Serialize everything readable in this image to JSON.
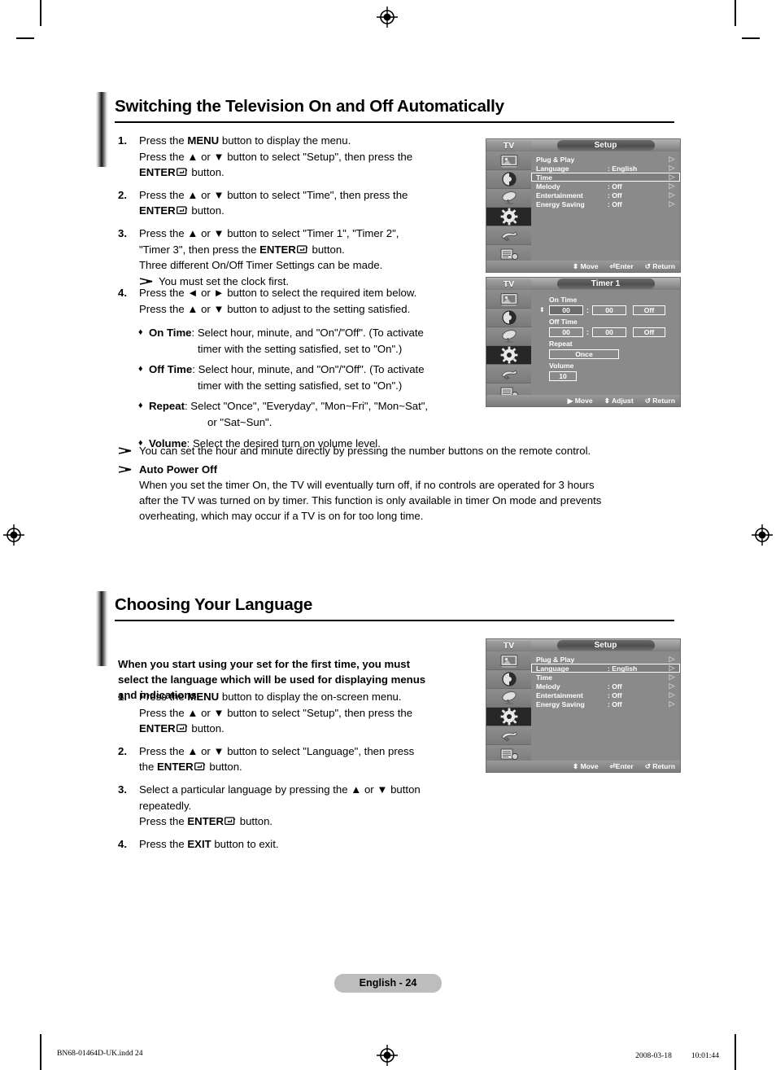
{
  "document": {
    "page_label": "English - 24",
    "footer_left": "BN68-01464D-UK.indd   24",
    "footer_right": "2008-03-18   　　 10:01:44"
  },
  "section1": {
    "title": "Switching the Television On and Off Automatically",
    "steps": [
      {
        "num": "1.",
        "lines": [
          "Press the MENU button to display the menu.",
          "Press the ▲ or ▼ button to select \"Setup\", then press the",
          "ENTER↵ button."
        ]
      },
      {
        "num": "2.",
        "lines": [
          "Press the ▲ or ▼ button to select \"Time\", then press the",
          "ENTER↵ button."
        ]
      },
      {
        "num": "3.",
        "lines": [
          "Press the ▲ or ▼ button to select \"Timer 1\", \"Timer 2\",",
          "\"Timer 3\", then press the ENTER↵ button.",
          "Three different On/Off Timer Settings can be made."
        ],
        "note": "You must set the clock first."
      },
      {
        "num": "4.",
        "lines": [
          "Press the ◄ or ► button to select the required item below.",
          "Press the ▲ or ▼ button to adjust to the setting satisfied."
        ]
      }
    ],
    "bullets": [
      {
        "label": "On  Time",
        "body": ": Select hour, minute, and \"On\"/\"Off\". (To activate",
        "body2": "timer with the setting satisfied, set to \"On\".)"
      },
      {
        "label": "Off  Time",
        "body": ": Select hour, minute, and \"On\"/\"Off\". (To activate",
        "body2": "timer with the setting satisfied, set to \"On\".)"
      },
      {
        "label": "Repeat",
        "body": ": Select \"Once\", \"Everyday\", \"Mon~Fri\", \"Mon~Sat\",",
        "body2": "or \"Sat~Sun\"."
      },
      {
        "label": "Volume",
        "body": ": Select the desired turn on volume level.",
        "body2": ""
      }
    ],
    "notes": [
      {
        "text": "You can set the hour and minute directly by pressing the number buttons on the remote control."
      },
      {
        "heading": "Auto Power Off",
        "lines": [
          "When you set the timer On, the TV will eventually turn off, if no controls are operated for 3 hours",
          "after the TV was turned on by timer. This function is only available in timer On mode and prevents",
          "overheating, which may occur if a TV is on for too long time."
        ]
      }
    ]
  },
  "section2": {
    "title": "Choosing Your Language",
    "intro": [
      "When you start using your set for the first time, you must",
      "select the language which will be used for displaying menus",
      "and indications."
    ],
    "steps": [
      {
        "num": "1.",
        "lines": [
          "Press the MENU button to display the on-screen menu.",
          "Press the ▲ or ▼ button to select \"Setup\", then press the",
          "ENTER↵ button."
        ]
      },
      {
        "num": "2.",
        "lines": [
          "Press the ▲ or ▼ button to select \"Language\", then press",
          "the ENTER↵ button."
        ]
      },
      {
        "num": "3.",
        "lines": [
          "Select a particular language by pressing the ▲ or ▼ button",
          "repeatedly.",
          "Press the ENTER↵ button."
        ]
      },
      {
        "num": "4.",
        "lines": [
          "Press the EXIT button to exit."
        ]
      }
    ]
  },
  "osd_setup_top": {
    "tv_label": "TV",
    "title": "Setup",
    "rows": [
      {
        "name": "Plug & Play",
        "value": "",
        "arrow": "▷",
        "selected": false
      },
      {
        "name": "Language",
        "value": ": English",
        "arrow": "▷",
        "selected": false
      },
      {
        "name": "Time",
        "value": "",
        "arrow": "▷",
        "selected": true
      },
      {
        "name": "Melody",
        "value": ": Off",
        "arrow": "▷",
        "selected": false
      },
      {
        "name": "Entertainment",
        "value": ": Off",
        "arrow": "▷",
        "selected": false
      },
      {
        "name": "Energy Saving",
        "value": ": Off",
        "arrow": "▷",
        "selected": false
      }
    ],
    "footer": {
      "move": "Move",
      "enter": "Enter",
      "return": "Return"
    },
    "icons": [
      "picture-icon",
      "sound-icon",
      "channel-icon",
      "setup-icon",
      "input-icon",
      "pc-setup-icon"
    ],
    "active_icon_index": 3
  },
  "osd_timer": {
    "tv_label": "TV",
    "title": "Timer 1",
    "on_time_label": "On Time",
    "on_time": {
      "hour": "00",
      "minute": "00",
      "state": "Off"
    },
    "off_time_label": "Off Time",
    "off_time": {
      "hour": "00",
      "minute": "00",
      "state": "Off"
    },
    "repeat_label": "Repeat",
    "repeat_value": "Once",
    "volume_label": "Volume",
    "volume_value": "10",
    "footer": {
      "move": "Move",
      "adjust": "Adjust",
      "return": "Return"
    }
  },
  "osd_setup_bottom": {
    "tv_label": "TV",
    "title": "Setup",
    "rows": [
      {
        "name": "Plug & Play",
        "value": "",
        "arrow": "▷",
        "selected": false
      },
      {
        "name": "Language",
        "value": ": English",
        "arrow": "▷",
        "selected": true
      },
      {
        "name": "Time",
        "value": "",
        "arrow": "▷",
        "selected": false
      },
      {
        "name": "Melody",
        "value": ": Off",
        "arrow": "▷",
        "selected": false
      },
      {
        "name": "Entertainment",
        "value": ": Off",
        "arrow": "▷",
        "selected": false
      },
      {
        "name": "Energy Saving",
        "value": ": Off",
        "arrow": "▷",
        "selected": false
      }
    ],
    "footer": {
      "move": "Move",
      "enter": "Enter",
      "return": "Return"
    }
  }
}
